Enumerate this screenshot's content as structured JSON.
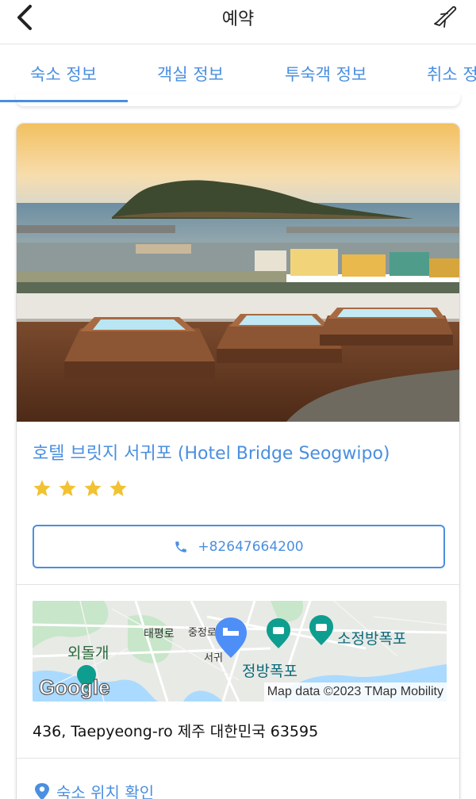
{
  "header": {
    "title": "예약",
    "back_icon": "chevron-left-icon",
    "action_icon": "plane-icon"
  },
  "tabs": [
    {
      "label": "숙소 정보",
      "active": true
    },
    {
      "label": "객실 정보",
      "active": false
    },
    {
      "label": "투숙객 정보",
      "active": false
    },
    {
      "label": "취소 정책",
      "active": false
    }
  ],
  "hotel": {
    "name": "호텔 브릿지 서귀포 (Hotel Bridge Seogwipo)",
    "star_rating": 4,
    "phone": "+82647664200",
    "address": "436, Taepyeong-ro 제주 대한민국 63595",
    "location_link": "숙소 위치 확인"
  },
  "map": {
    "labels": {
      "place1": "외돌개",
      "place2": "태평로",
      "place3": "중정로",
      "place4": "서귀",
      "place5": "정방폭포",
      "place6": "소정방폭포"
    },
    "attribution": "Map data ©2023 TMap Mobility",
    "logo_text": "Google"
  },
  "colors": {
    "accent": "#4a8fe0",
    "star": "#f1c232",
    "map_water": "#aadaff",
    "map_land": "#e8eae6",
    "map_park": "#c8e6c9",
    "map_marker": "#4e8ef7",
    "map_poi": "#0e9e8f"
  }
}
